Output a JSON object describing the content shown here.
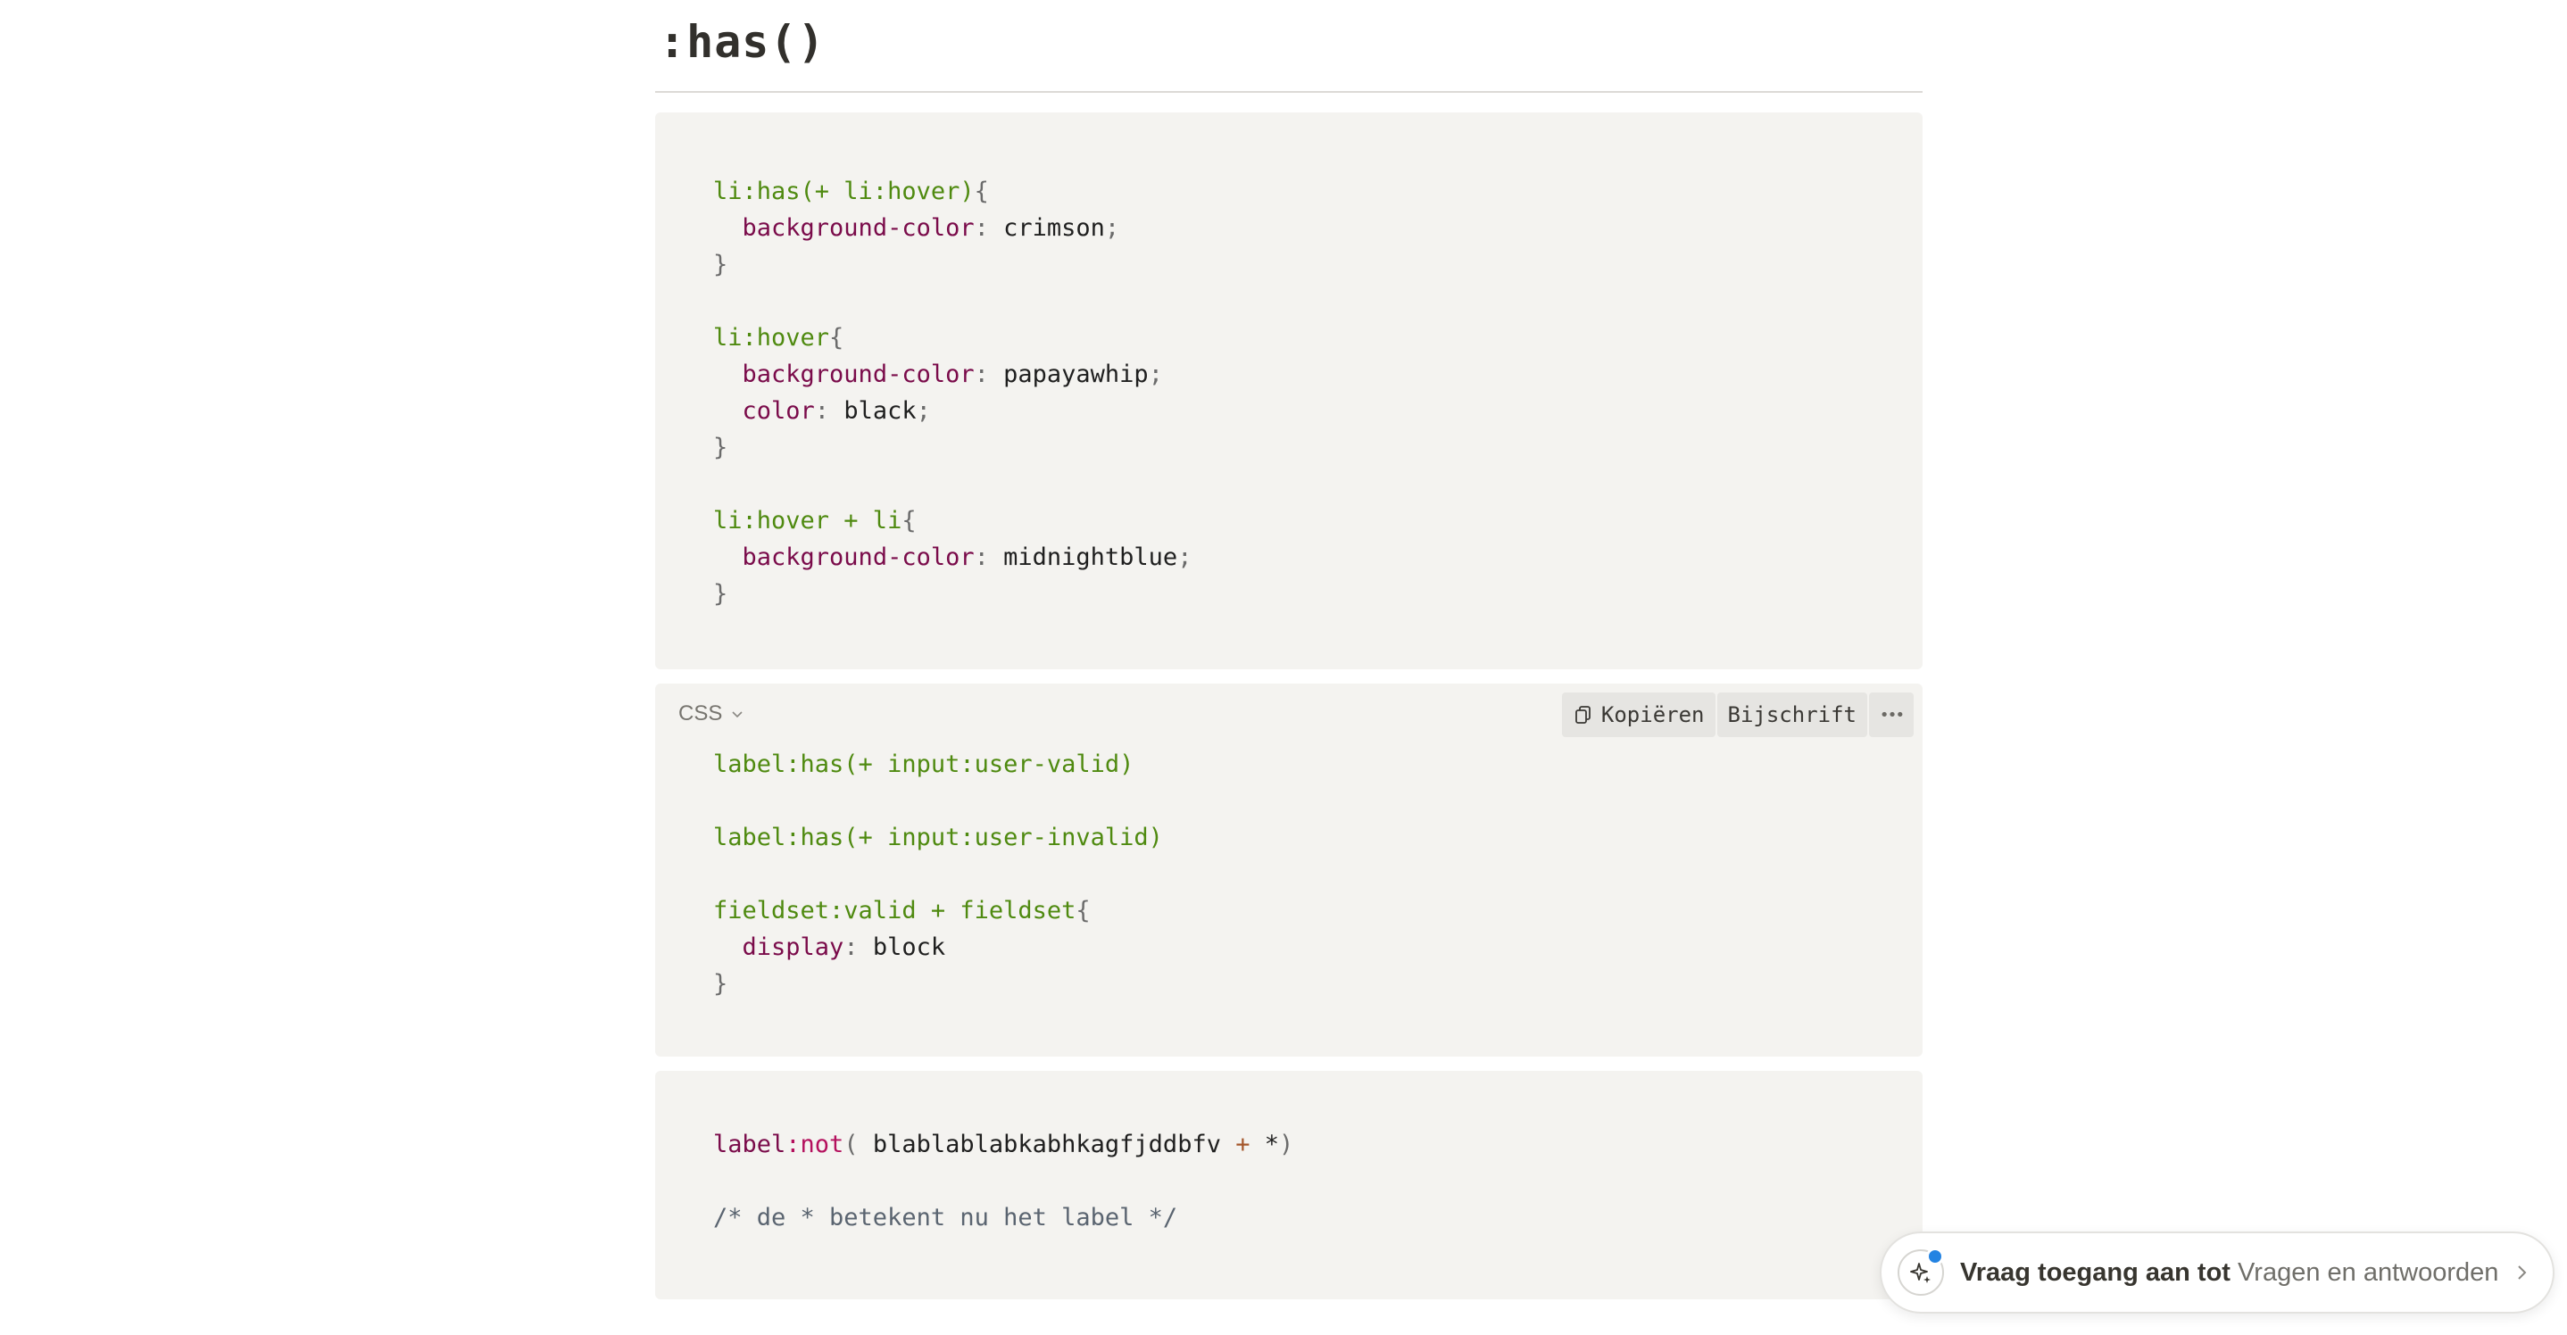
{
  "heading": ":has()",
  "block1": {
    "lines": [
      [
        [
          "sel",
          "li:has(+ li:hover)"
        ],
        [
          "punc",
          "{"
        ]
      ],
      [
        [
          "sp",
          "  "
        ],
        [
          "prop",
          "background-color"
        ],
        [
          "punc",
          ": "
        ],
        [
          "val",
          "crimson"
        ],
        [
          "punc",
          ";"
        ]
      ],
      [
        [
          "punc",
          "}"
        ]
      ],
      [],
      [
        [
          "sel",
          "li:hover"
        ],
        [
          "punc",
          "{"
        ]
      ],
      [
        [
          "sp",
          "  "
        ],
        [
          "prop",
          "background-color"
        ],
        [
          "punc",
          ": "
        ],
        [
          "val",
          "papayawhip"
        ],
        [
          "punc",
          ";"
        ]
      ],
      [
        [
          "sp",
          "  "
        ],
        [
          "prop",
          "color"
        ],
        [
          "punc",
          ": "
        ],
        [
          "val",
          "black"
        ],
        [
          "punc",
          ";"
        ]
      ],
      [
        [
          "punc",
          "}"
        ]
      ],
      [],
      [
        [
          "sel",
          "li:hover + li"
        ],
        [
          "punc",
          "{"
        ]
      ],
      [
        [
          "sp",
          "  "
        ],
        [
          "prop",
          "background-color"
        ],
        [
          "punc",
          ": "
        ],
        [
          "val",
          "midnightblue"
        ],
        [
          "punc",
          ";"
        ]
      ],
      [
        [
          "punc",
          "}"
        ]
      ]
    ]
  },
  "block2": {
    "language": "CSS",
    "toolbar": {
      "copy_label": "Kopiëren",
      "caption_label": "Bijschrift",
      "more_label": "•••"
    },
    "lines": [
      [
        [
          "sel",
          "label:has(+ input:user-valid)"
        ]
      ],
      [],
      [
        [
          "sel",
          "label:has(+ input:user-invalid)"
        ]
      ],
      [],
      [
        [
          "sel",
          "fieldset:valid + fieldset"
        ],
        [
          "punc",
          "{"
        ]
      ],
      [
        [
          "sp",
          "  "
        ],
        [
          "prop",
          "display"
        ],
        [
          "punc",
          ": "
        ],
        [
          "val",
          "block"
        ]
      ],
      [
        [
          "punc",
          "}"
        ]
      ]
    ]
  },
  "block3": {
    "lines": [
      [
        [
          "prop",
          "label"
        ],
        [
          "kw",
          ":not"
        ],
        [
          "punc",
          "( "
        ],
        [
          "val",
          "blablablabkabhkagfjddbfv "
        ],
        [
          "op",
          "+"
        ],
        [
          "val",
          " *"
        ],
        [
          "punc",
          ")"
        ]
      ],
      [],
      [
        [
          "cmt",
          "/* de * betekent nu het label */"
        ]
      ]
    ]
  },
  "ask": {
    "prefix": "Vraag toegang aan tot",
    "target": "Vragen en antwoorden"
  },
  "colors": {
    "code_bg": "#f4f3f0",
    "selector": "#4f8a10",
    "property": "#7a0b4a",
    "accent_dot": "#2383e2"
  }
}
